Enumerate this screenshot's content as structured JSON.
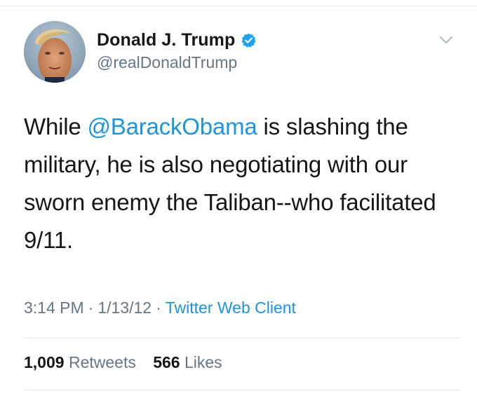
{
  "user": {
    "display_name": "Donald J. Trump",
    "handle": "@realDonaldTrump",
    "verified_icon": "verified-badge-icon",
    "verified_color": "#1da1f2"
  },
  "tweet": {
    "text_before": "While ",
    "mention": "@BarackObama",
    "text_after": " is slashing the military, he is also negotiating with our sworn enemy the Taliban--who facilitated 9/11."
  },
  "meta": {
    "time": "3:14 PM",
    "separator": "·",
    "date": "1/13/12",
    "source": "Twitter Web Client"
  },
  "stats": {
    "retweets_count": "1,009",
    "retweets_label": "Retweets",
    "likes_count": "566",
    "likes_label": "Likes"
  },
  "colors": {
    "link": "#1b95e0",
    "secondary_text": "#657786",
    "primary_text": "#14171a",
    "divider": "#e6ecf0"
  },
  "icons": {
    "menu": "chevron-down-icon"
  }
}
